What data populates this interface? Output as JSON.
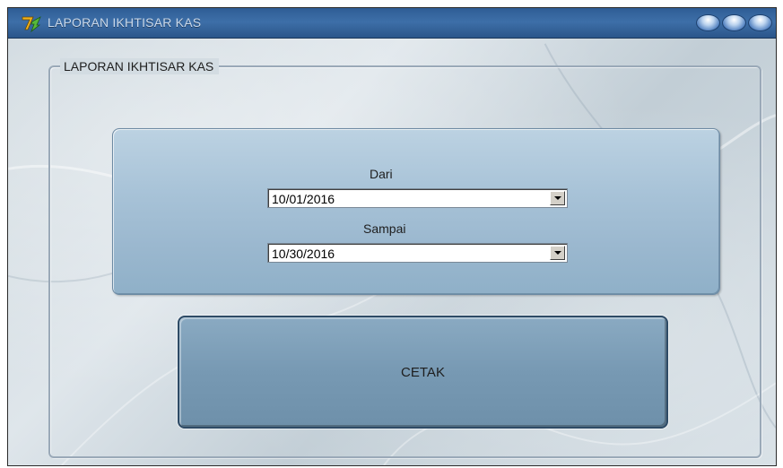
{
  "window": {
    "title": "LAPORAN IKHTISAR KAS"
  },
  "group": {
    "caption": "LAPORAN IKHTISAR KAS"
  },
  "form": {
    "dari_label": "Dari",
    "dari_value": "10/01/2016",
    "sampai_label": "Sampai",
    "sampai_value": "10/30/2016"
  },
  "actions": {
    "cetak_label": "CETAK"
  },
  "icons": {
    "app": "app-icon",
    "window_buttons": [
      "minimize-icon",
      "maximize-icon",
      "close-icon"
    ],
    "dropdown": "chevron-down-icon"
  },
  "colors": {
    "titlebar": "#2f5d95",
    "panel": "#a7c2d7",
    "button": "#7799b3"
  }
}
